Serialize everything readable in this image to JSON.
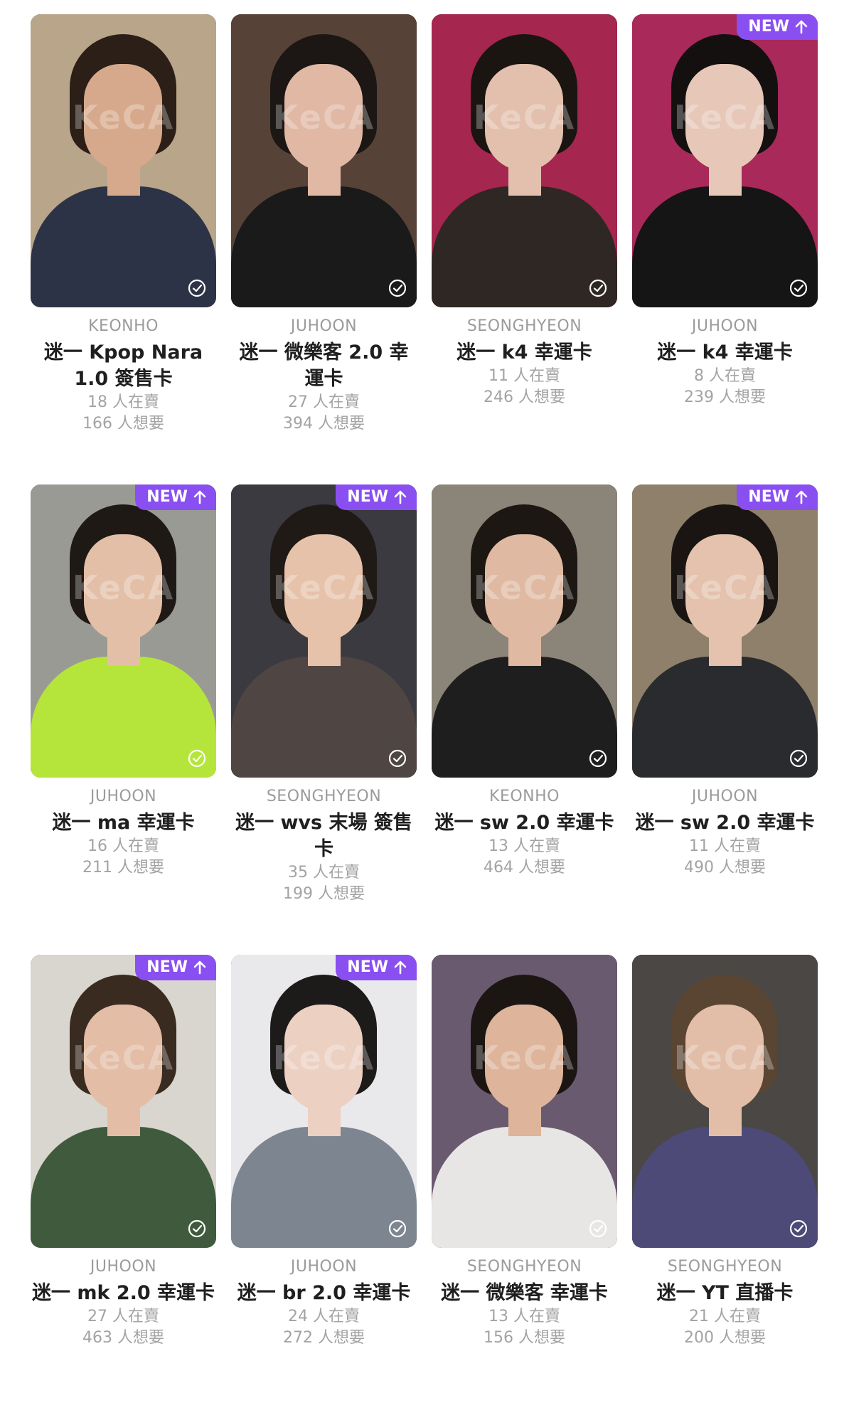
{
  "badge_label": "NEW",
  "colors": {
    "accent": "#8a4ff0",
    "member_text": "#9b9b9b",
    "title_text": "#1f1f1f",
    "stat_text": "#a3a3a3"
  },
  "photo_watermark": "KeCA",
  "cards": [
    {
      "member": "KEONHO",
      "title": "迷一 Kpop Nara 1.0 簽售卡",
      "sellers": "18 人在賣",
      "wants": "166 人想要",
      "is_new": false,
      "palette": {
        "bg": "#b9a58a",
        "hair": "#2b1f17",
        "skin": "#d7a98c",
        "shirt": "#2d3346"
      }
    },
    {
      "member": "JUHOON",
      "title": "迷一 微樂客 2.0 幸運卡",
      "sellers": "27 人在賣",
      "wants": "394 人想要",
      "is_new": false,
      "palette": {
        "bg": "#574238",
        "hair": "#1c1714",
        "skin": "#e0b8a4",
        "shirt": "#1a1a1a"
      }
    },
    {
      "member": "SEONGHYEON",
      "title": "迷一 k4 幸運卡",
      "sellers": "11 人在賣",
      "wants": "246 人想要",
      "is_new": false,
      "palette": {
        "bg": "#a5264f",
        "hair": "#1b1512",
        "skin": "#e3c0ad",
        "shirt": "#2e2723"
      }
    },
    {
      "member": "JUHOON",
      "title": "迷一 k4 幸運卡",
      "sellers": "8 人在賣",
      "wants": "239 人想要",
      "is_new": true,
      "palette": {
        "bg": "#a8295a",
        "hair": "#141010",
        "skin": "#e6c7b8",
        "shirt": "#151515"
      }
    },
    {
      "member": "JUHOON",
      "title": "迷一 ma 幸運卡",
      "sellers": "16 人在賣",
      "wants": "211 人想要",
      "is_new": true,
      "palette": {
        "bg": "#9a9a94",
        "hair": "#1e1915",
        "skin": "#e4bfa8",
        "shirt": "#b5e53a"
      }
    },
    {
      "member": "SEONGHYEON",
      "title": "迷一 wvs 末場 簽售卡",
      "sellers": "35 人在賣",
      "wants": "199 人想要",
      "is_new": true,
      "palette": {
        "bg": "#3b3a40",
        "hair": "#1f1a16",
        "skin": "#e7c2aa",
        "shirt": "#4f4643"
      }
    },
    {
      "member": "KEONHO",
      "title": "迷一 sw 2.0 幸運卡",
      "sellers": "13 人在賣",
      "wants": "464 人想要",
      "is_new": false,
      "palette": {
        "bg": "#8b8478",
        "hair": "#1d1713",
        "skin": "#dfb9a2",
        "shirt": "#1e1e1e"
      }
    },
    {
      "member": "JUHOON",
      "title": "迷一 sw 2.0 幸運卡",
      "sellers": "11 人在賣",
      "wants": "490 人想要",
      "is_new": true,
      "palette": {
        "bg": "#8e806a",
        "hair": "#1a1512",
        "skin": "#e4c2ad",
        "shirt": "#2a2b2e"
      }
    },
    {
      "member": "JUHOON",
      "title": "迷一 mk 2.0 幸運卡",
      "sellers": "27 人在賣",
      "wants": "463 人想要",
      "is_new": true,
      "palette": {
        "bg": "#d9d5cf",
        "hair": "#3a2b20",
        "skin": "#e3bda6",
        "shirt": "#3f5a3c"
      }
    },
    {
      "member": "JUHOON",
      "title": "迷一 br 2.0 幸運卡",
      "sellers": "24 人在賣",
      "wants": "272 人想要",
      "is_new": true,
      "palette": {
        "bg": "#e9e9ec",
        "hair": "#1d1a1a",
        "skin": "#ecd0c2",
        "shirt": "#7d8591"
      }
    },
    {
      "member": "SEONGHYEON",
      "title": "迷一 微樂客 幸運卡",
      "sellers": "13 人在賣",
      "wants": "156 人想要",
      "is_new": false,
      "palette": {
        "bg": "#6a5a70",
        "hair": "#1c1613",
        "skin": "#deb49b",
        "shirt": "#e8e6e4"
      }
    },
    {
      "member": "SEONGHYEON",
      "title": "迷一 YT 直播卡",
      "sellers": "21 人在賣",
      "wants": "200 人想要",
      "is_new": false,
      "palette": {
        "bg": "#4a4744",
        "hair": "#5a4532",
        "skin": "#e2bea8",
        "shirt": "#4d4a78"
      }
    }
  ]
}
